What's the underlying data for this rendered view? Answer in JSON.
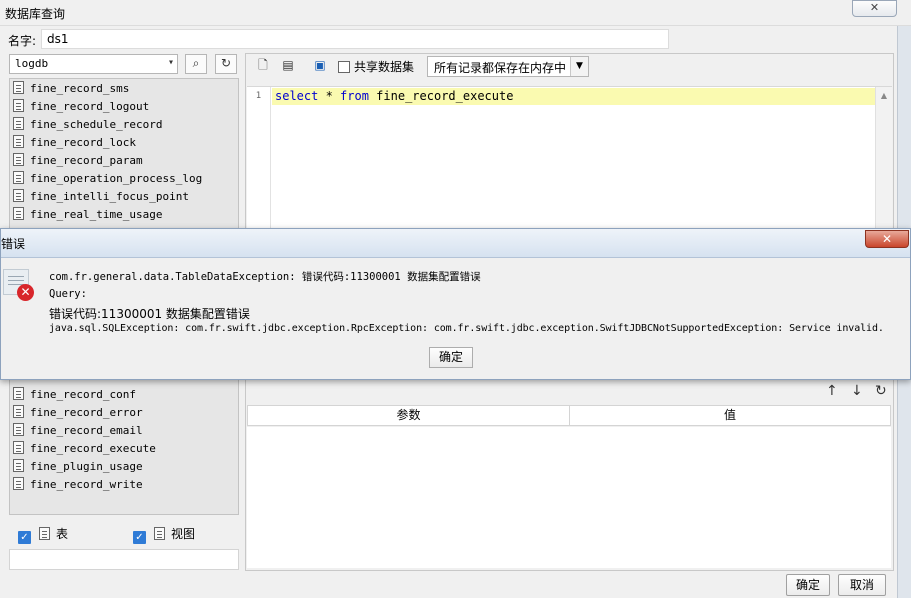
{
  "window": {
    "title": "数据库查询",
    "close_glyph": "✕"
  },
  "name_field": {
    "label": "名字:",
    "value": "ds1"
  },
  "left_panel": {
    "db_select": "logdb",
    "tables_visible_top": [
      "fine_record_sms",
      "fine_record_logout",
      "fine_schedule_record",
      "fine_record_lock",
      "fine_record_param",
      "fine_operation_process_log",
      "fine_intelli_focus_point",
      "fine_real_time_usage"
    ],
    "tables_visible_bottom": [
      "fine_record_conf",
      "fine_record_error",
      "fine_record_email",
      "fine_record_execute",
      "fine_plugin_usage",
      "fine_record_write"
    ],
    "filter_table_label": "表",
    "filter_view_label": "视图"
  },
  "toolbar": {
    "share_dataset_label": "共享数据集",
    "memory_mode": "所有记录都保存在内存中"
  },
  "editor": {
    "line_number": "1",
    "kw_select": "select",
    "star": " * ",
    "kw_from": "from",
    "table": " fine_record_execute"
  },
  "params": {
    "col_param": "参数",
    "col_value": "值"
  },
  "footer": {
    "ok": "确定",
    "cancel": "取消"
  },
  "error_dialog": {
    "title": "错误",
    "line1": "com.fr.general.data.TableDataException: 错误代码:11300001 数据集配置错误",
    "line2": "Query:",
    "line3": "错误代码:11300001 数据集配置错误",
    "line4": "java.sql.SQLException: com.fr.swift.jdbc.exception.RpcException: com.fr.swift.jdbc.exception.SwiftJDBCNotSupportedException: Service invalid.",
    "ok": "确定",
    "close_glyph": "✕"
  }
}
